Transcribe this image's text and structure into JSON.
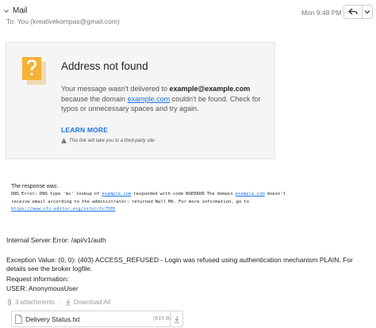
{
  "header": {
    "sender": "Mail",
    "to": "To:  You (kreativekompas@gmail.com)",
    "timestamp": "Mon 9:48 PM"
  },
  "card": {
    "title": "Address not found",
    "msg_prefix": "Your message wasn't delivered to ",
    "recipient": "example@example.com",
    "msg_mid": "because the domain ",
    "domain": "example.com",
    "msg_suffix": " couldn't be found. Check for typos or unnecessary spaces and try again.",
    "learn_more": "LEARN MORE",
    "disclaimer": "This link will take you to a third-party site"
  },
  "response": {
    "heading": "The response was:",
    "line1_a": "DNS Error: DNS type 'mx' lookup of ",
    "line1_link1": "example.com",
    "line1_b": " responded with code NOERROR The domain ",
    "line1_link2": "example.com",
    "line1_c": " doesn't",
    "line2": "receive email according to the administrator: returned Null MX. For more information, go to",
    "line3_link": "https://www.rfc-editor.org/info/rfc7505"
  },
  "error": {
    "server_error": "Internal Server Error: /api/v1/auth",
    "exception": "Exception Value: (0, 0): (403) ACCESS_REFUSED - Login was refused using authentication mechanism PLAIN. For details see the broker logfile.",
    "request_info": "Request information:",
    "user": "USER: AnonymousUser"
  },
  "attachments": {
    "count_label": "3 attachments",
    "download_all": "Download All",
    "file_name": "Delivery Status.txt",
    "file_size": "(615 B)"
  },
  "colors": {
    "link": "#1a73e8",
    "warning": "#f6b236",
    "card_bg": "#f5f5f5"
  },
  "icons": [
    "expand-icon",
    "reply-icon",
    "more-options-icon",
    "warning-icon",
    "paperclip-icon",
    "download-icon",
    "file-icon"
  ]
}
